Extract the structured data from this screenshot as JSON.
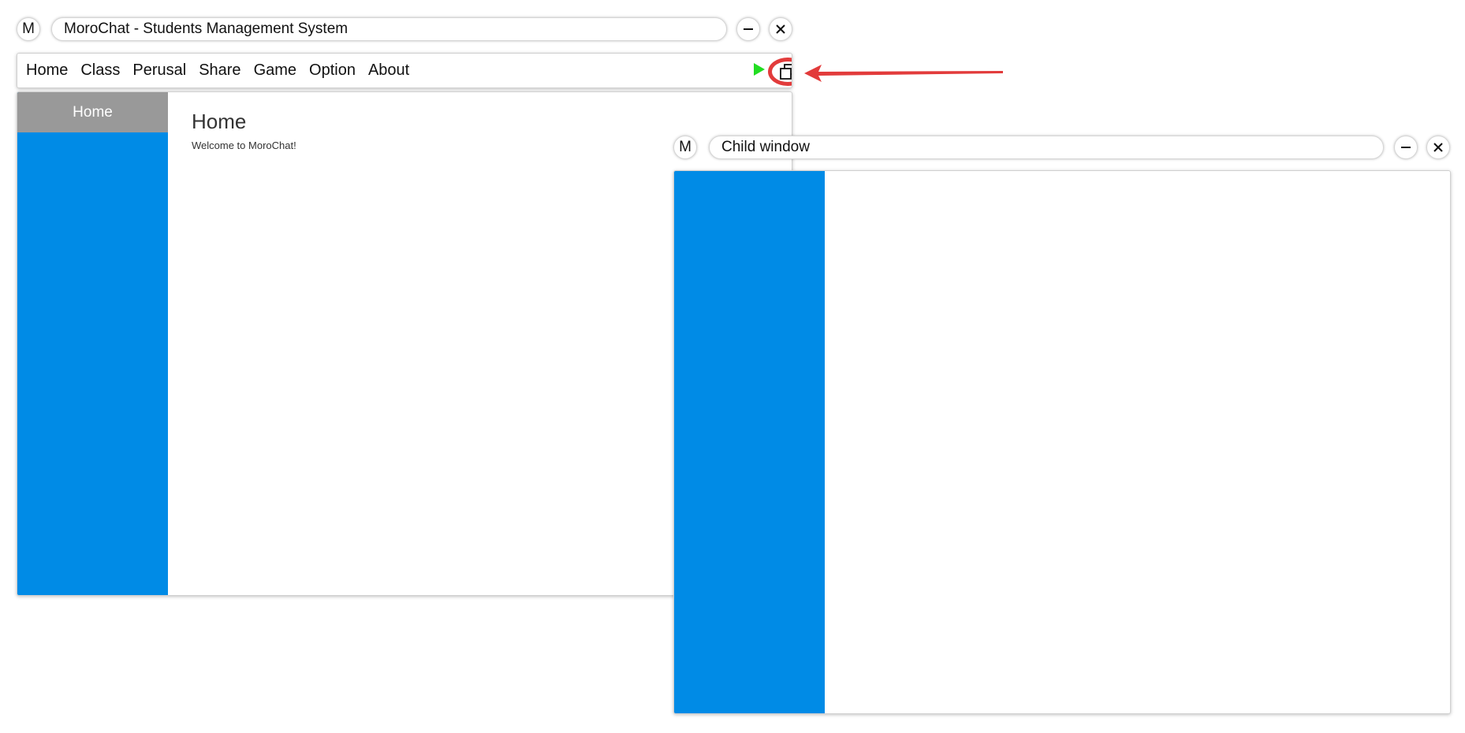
{
  "colors": {
    "sidebar_blue": "#008be6",
    "sidebar_selected_gray": "#999999",
    "play_green": "#22dd22",
    "annotation_red": "#e23b3b"
  },
  "main_window": {
    "logo_letter": "M",
    "title": "MoroChat - Students Management System",
    "minimize_icon": "minimize-icon",
    "close_icon": "close-icon",
    "menu": [
      "Home",
      "Class",
      "Perusal",
      "Share",
      "Game",
      "Option",
      "About"
    ],
    "play_icon": "play-icon",
    "restore_icon": "restore-window-icon",
    "sidebar": {
      "selected_item": "Home"
    },
    "content": {
      "title": "Home",
      "subtitle": "Welcome to MoroChat!"
    }
  },
  "child_window": {
    "logo_letter": "M",
    "title": "Child window",
    "minimize_icon": "minimize-icon",
    "close_icon": "close-icon"
  }
}
